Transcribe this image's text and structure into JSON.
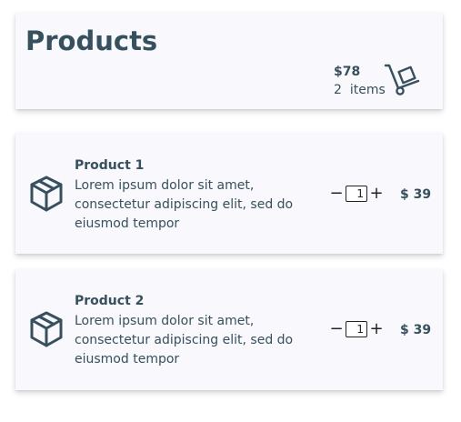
{
  "header": {
    "title": "Products",
    "cart_total": "$78",
    "cart_count": "2",
    "cart_items_label": "items"
  },
  "products": [
    {
      "name": "Product 1",
      "description": "Lorem ipsum dolor sit amet, consectetur adipiscing elit, sed do eiusmod tempor",
      "quantity": "1",
      "price": "$ 39",
      "minus_label": "−",
      "plus_label": "+"
    },
    {
      "name": "Product 2",
      "description": "Lorem ipsum dolor sit amet, consectetur adipiscing elit, sed do eiusmod tempor",
      "quantity": "1",
      "price": "$ 39",
      "minus_label": "−",
      "plus_label": "+"
    }
  ],
  "icons": {
    "cart": "hand-truck-icon",
    "product": "box-icon"
  },
  "colors": {
    "text": "#36505e",
    "card_background": "#f8f8fd"
  }
}
